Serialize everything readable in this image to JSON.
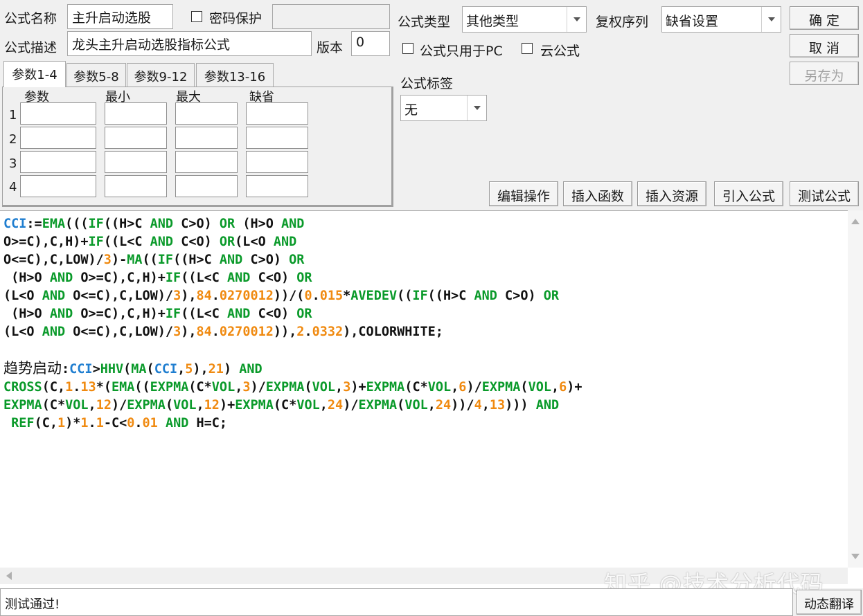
{
  "form": {
    "name_label": "公式名称",
    "name_value": "主升启动选股",
    "password_label": "密码保护",
    "desc_label": "公式描述",
    "desc_value": "龙头主升启动选股指标公式",
    "version_label": "版本",
    "version_value": "0",
    "type_label": "公式类型",
    "type_value": "其他类型",
    "restore_label": "复权序列",
    "restore_value": "缺省设置",
    "pc_only_label": "公式只用于PC",
    "cloud_label": "云公式",
    "tag_label": "公式标签",
    "tag_value": "无"
  },
  "buttons": {
    "ok": "确 定",
    "cancel": "取 消",
    "save_as": "另存为",
    "edit_ops": "编辑操作",
    "insert_func": "插入函数",
    "insert_res": "插入资源",
    "import_formula": "引入公式",
    "test_formula": "测试公式",
    "dynamic_translate": "动态翻译"
  },
  "tabs": [
    "参数1-4",
    "参数5-8",
    "参数9-12",
    "参数13-16"
  ],
  "params": {
    "headers": [
      "参数",
      "最小",
      "最大",
      "缺省"
    ],
    "rows": [
      "1",
      "2",
      "3",
      "4"
    ]
  },
  "status": "测试通过!",
  "watermark": "知乎 @技术分析代码",
  "colors": {
    "keyword": "#0a9a2a",
    "number": "#f08a10",
    "variable": "#1f7ed0"
  }
}
